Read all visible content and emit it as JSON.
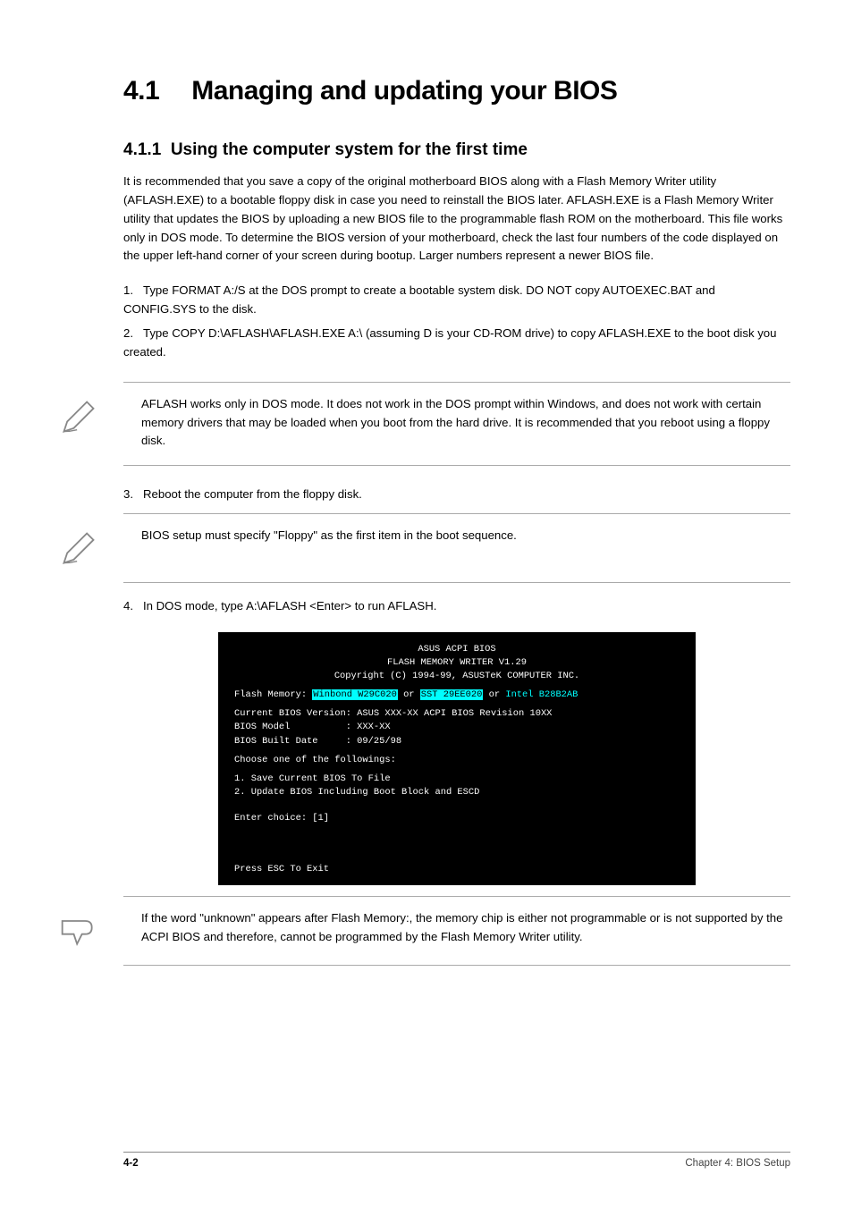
{
  "section": {
    "number": "4.1",
    "title": "Managing and updating your BIOS"
  },
  "sub1": {
    "number": "4.1.1",
    "title": "Using the computer system for the first time"
  },
  "p1": "It is recommended that you save a copy of the original motherboard BIOS along with a Flash Memory Writer utility (AFLASH.EXE) to a bootable floppy disk in case you need to reinstall the BIOS later. AFLASH.EXE is a Flash Memory Writer utility that updates the BIOS by uploading a new BIOS file to the programmable flash ROM on the motherboard. This file works only in DOS mode. To determine the BIOS version of your motherboard, check the last four numbers of the code displayed on the upper left-hand corner of your screen during bootup. Larger numbers represent a newer BIOS file.",
  "list1": {
    "i1_num": "1.",
    "i1_text": "Type FORMAT A:/S at the DOS prompt to create a bootable system disk. DO NOT copy AUTOEXEC.BAT and CONFIG.SYS to the disk.",
    "i2_num": "2.",
    "i2_text": "Type COPY D:\\AFLASH\\AFLASH.EXE A:\\ (assuming D is your CD-ROM drive) to copy AFLASH.EXE to the boot disk you created."
  },
  "note1": "AFLASH works only in DOS mode. It does not work in the DOS prompt within Windows, and does not work with certain memory drivers that may be loaded when you boot from the hard drive. It is recommended that you reboot using a floppy disk.",
  "list2": {
    "i3_num": "3.",
    "i3_text": "Reboot the computer from the floppy disk."
  },
  "note2": "BIOS setup must specify \"Floppy\" as the first item in the boot sequence.",
  "list3": {
    "i4_num": "4.",
    "i4_text": "In DOS mode, type A:\\AFLASH <Enter> to run AFLASH."
  },
  "terminal": {
    "l1": "ASUS ACPI BIOS",
    "l2": "FLASH MEMORY WRITER V1.29",
    "l3": "Copyright (C) 1994-99, ASUSTeK COMPUTER INC.",
    "flash_label": "Flash Memory: ",
    "flash_a": "Winbond W29C020",
    "or1": " or ",
    "flash_b": "SST 29EE020",
    "or2": " or ",
    "flash_c": "Intel B28B2AB",
    "curver": "Current BIOS Version: ASUS XXX-XX ACPI BIOS Revision 10XX",
    "model": "BIOS Model          : XXX-XX",
    "built": "BIOS Built Date     : 09/25/98",
    "choose": "Choose one of the followings:",
    "opt1": "1. Save Current BIOS To File",
    "opt2": "2. Update BIOS Including Boot Block and ESCD",
    "enter": "Enter choice: [1]",
    "esc": "Press ESC To Exit"
  },
  "note3": "If the word \"unknown\" appears after Flash Memory:, the memory chip is either not programmable or is not supported by the ACPI BIOS and therefore, cannot be programmed by the Flash Memory Writer utility.",
  "footer": {
    "page": "4-2",
    "chapter": "Chapter 4: BIOS Setup"
  }
}
